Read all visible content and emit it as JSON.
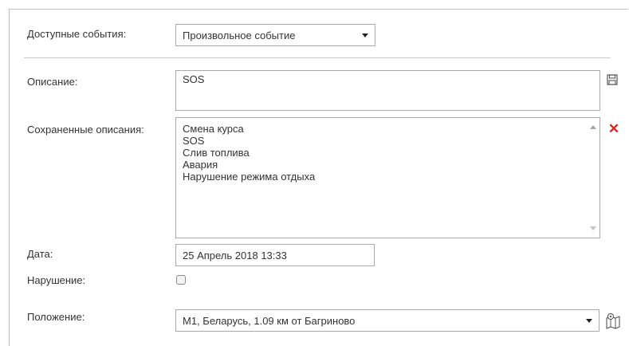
{
  "available_events": {
    "label": "Доступные события:",
    "selected": "Произвольное событие"
  },
  "description": {
    "label": "Описание:",
    "value": "SOS"
  },
  "saved_descriptions": {
    "label": "Сохраненные описания:",
    "items": [
      "Смена курса",
      "SOS",
      "Слив топлива",
      "Авария",
      "Нарушение режима отдыха"
    ]
  },
  "date": {
    "label": "Дата:",
    "value": "25 Апрель 2018 13:33"
  },
  "violation": {
    "label": "Нарушение:",
    "checked": false
  },
  "position": {
    "label": "Положение:",
    "selected": "M1, Беларусь, 1.09 км от Багриново"
  },
  "icons": {
    "save": "save-icon",
    "delete": "delete-icon",
    "map": "map-pin-icon"
  },
  "colors": {
    "delete": "#e02020"
  }
}
